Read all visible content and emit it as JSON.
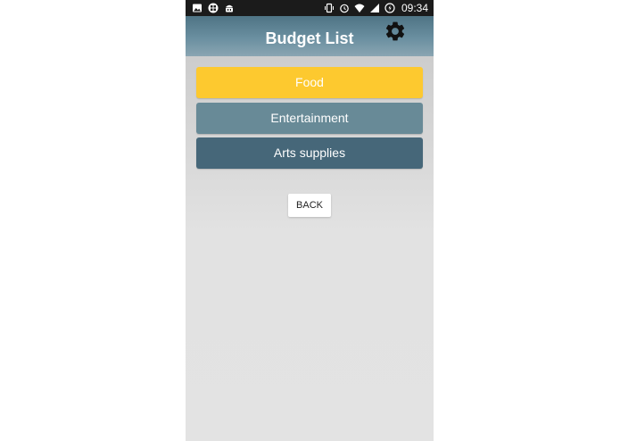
{
  "status_bar": {
    "time": "09:34",
    "left_icons": [
      "image-icon",
      "app-icon",
      "android-icon"
    ],
    "right_icons": [
      "vibrate-icon",
      "alarm-icon",
      "wifi-icon",
      "signal-icon",
      "battery-icon"
    ]
  },
  "appbar": {
    "title": "Budget List",
    "settings_icon": "gear-icon"
  },
  "budgets": [
    {
      "label": "Food",
      "color": "#fdc92f"
    },
    {
      "label": "Entertainment",
      "color": "#688a97"
    },
    {
      "label": "Arts supplies",
      "color": "#466779"
    }
  ],
  "back_button": {
    "label": "BACK"
  }
}
